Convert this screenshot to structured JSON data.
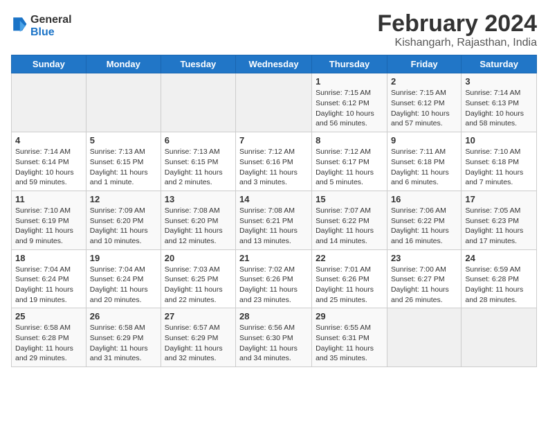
{
  "header": {
    "logo_line1": "General",
    "logo_line2": "Blue",
    "month_year": "February 2024",
    "location": "Kishangarh, Rajasthan, India"
  },
  "weekdays": [
    "Sunday",
    "Monday",
    "Tuesday",
    "Wednesday",
    "Thursday",
    "Friday",
    "Saturday"
  ],
  "weeks": [
    [
      {
        "day": "",
        "info": ""
      },
      {
        "day": "",
        "info": ""
      },
      {
        "day": "",
        "info": ""
      },
      {
        "day": "",
        "info": ""
      },
      {
        "day": "1",
        "info": "Sunrise: 7:15 AM\nSunset: 6:12 PM\nDaylight: 10 hours\nand 56 minutes."
      },
      {
        "day": "2",
        "info": "Sunrise: 7:15 AM\nSunset: 6:12 PM\nDaylight: 10 hours\nand 57 minutes."
      },
      {
        "day": "3",
        "info": "Sunrise: 7:14 AM\nSunset: 6:13 PM\nDaylight: 10 hours\nand 58 minutes."
      }
    ],
    [
      {
        "day": "4",
        "info": "Sunrise: 7:14 AM\nSunset: 6:14 PM\nDaylight: 10 hours\nand 59 minutes."
      },
      {
        "day": "5",
        "info": "Sunrise: 7:13 AM\nSunset: 6:15 PM\nDaylight: 11 hours\nand 1 minute."
      },
      {
        "day": "6",
        "info": "Sunrise: 7:13 AM\nSunset: 6:15 PM\nDaylight: 11 hours\nand 2 minutes."
      },
      {
        "day": "7",
        "info": "Sunrise: 7:12 AM\nSunset: 6:16 PM\nDaylight: 11 hours\nand 3 minutes."
      },
      {
        "day": "8",
        "info": "Sunrise: 7:12 AM\nSunset: 6:17 PM\nDaylight: 11 hours\nand 5 minutes."
      },
      {
        "day": "9",
        "info": "Sunrise: 7:11 AM\nSunset: 6:18 PM\nDaylight: 11 hours\nand 6 minutes."
      },
      {
        "day": "10",
        "info": "Sunrise: 7:10 AM\nSunset: 6:18 PM\nDaylight: 11 hours\nand 7 minutes."
      }
    ],
    [
      {
        "day": "11",
        "info": "Sunrise: 7:10 AM\nSunset: 6:19 PM\nDaylight: 11 hours\nand 9 minutes."
      },
      {
        "day": "12",
        "info": "Sunrise: 7:09 AM\nSunset: 6:20 PM\nDaylight: 11 hours\nand 10 minutes."
      },
      {
        "day": "13",
        "info": "Sunrise: 7:08 AM\nSunset: 6:20 PM\nDaylight: 11 hours\nand 12 minutes."
      },
      {
        "day": "14",
        "info": "Sunrise: 7:08 AM\nSunset: 6:21 PM\nDaylight: 11 hours\nand 13 minutes."
      },
      {
        "day": "15",
        "info": "Sunrise: 7:07 AM\nSunset: 6:22 PM\nDaylight: 11 hours\nand 14 minutes."
      },
      {
        "day": "16",
        "info": "Sunrise: 7:06 AM\nSunset: 6:22 PM\nDaylight: 11 hours\nand 16 minutes."
      },
      {
        "day": "17",
        "info": "Sunrise: 7:05 AM\nSunset: 6:23 PM\nDaylight: 11 hours\nand 17 minutes."
      }
    ],
    [
      {
        "day": "18",
        "info": "Sunrise: 7:04 AM\nSunset: 6:24 PM\nDaylight: 11 hours\nand 19 minutes."
      },
      {
        "day": "19",
        "info": "Sunrise: 7:04 AM\nSunset: 6:24 PM\nDaylight: 11 hours\nand 20 minutes."
      },
      {
        "day": "20",
        "info": "Sunrise: 7:03 AM\nSunset: 6:25 PM\nDaylight: 11 hours\nand 22 minutes."
      },
      {
        "day": "21",
        "info": "Sunrise: 7:02 AM\nSunset: 6:26 PM\nDaylight: 11 hours\nand 23 minutes."
      },
      {
        "day": "22",
        "info": "Sunrise: 7:01 AM\nSunset: 6:26 PM\nDaylight: 11 hours\nand 25 minutes."
      },
      {
        "day": "23",
        "info": "Sunrise: 7:00 AM\nSunset: 6:27 PM\nDaylight: 11 hours\nand 26 minutes."
      },
      {
        "day": "24",
        "info": "Sunrise: 6:59 AM\nSunset: 6:28 PM\nDaylight: 11 hours\nand 28 minutes."
      }
    ],
    [
      {
        "day": "25",
        "info": "Sunrise: 6:58 AM\nSunset: 6:28 PM\nDaylight: 11 hours\nand 29 minutes."
      },
      {
        "day": "26",
        "info": "Sunrise: 6:58 AM\nSunset: 6:29 PM\nDaylight: 11 hours\nand 31 minutes."
      },
      {
        "day": "27",
        "info": "Sunrise: 6:57 AM\nSunset: 6:29 PM\nDaylight: 11 hours\nand 32 minutes."
      },
      {
        "day": "28",
        "info": "Sunrise: 6:56 AM\nSunset: 6:30 PM\nDaylight: 11 hours\nand 34 minutes."
      },
      {
        "day": "29",
        "info": "Sunrise: 6:55 AM\nSunset: 6:31 PM\nDaylight: 11 hours\nand 35 minutes."
      },
      {
        "day": "",
        "info": ""
      },
      {
        "day": "",
        "info": ""
      }
    ]
  ]
}
